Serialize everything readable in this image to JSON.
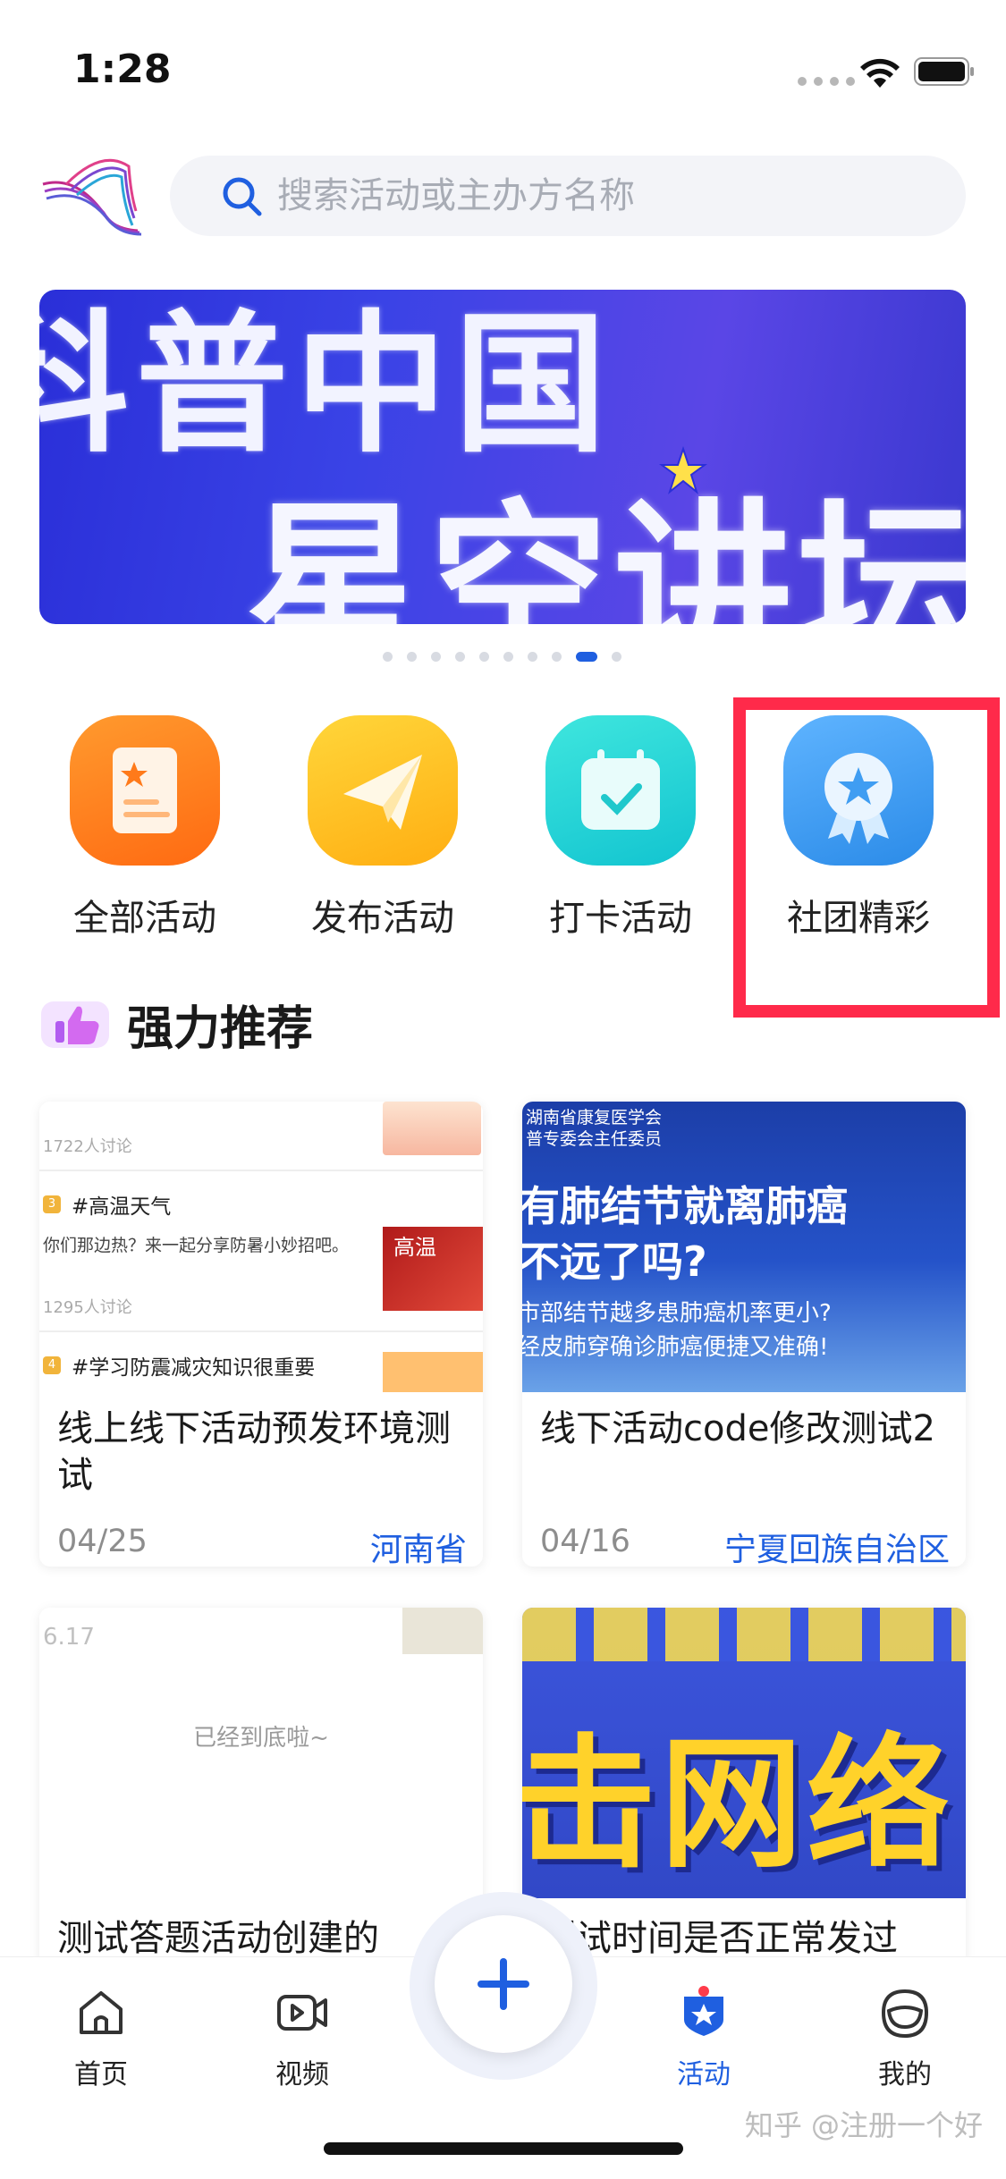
{
  "status_bar": {
    "time": "1:28"
  },
  "search": {
    "placeholder": "搜索活动或主办方名称"
  },
  "banner": {
    "line1": "科普中国",
    "line2": "星空讲坛",
    "page_count": 10,
    "active_page": 9
  },
  "quick_actions": [
    {
      "label": "全部活动",
      "icon": "document-star-icon",
      "color": "#ff7a1a"
    },
    {
      "label": "发布活动",
      "icon": "paper-plane-icon",
      "color": "#ffbf1f"
    },
    {
      "label": "打卡活动",
      "icon": "calendar-check-icon",
      "color": "#20d8d0"
    },
    {
      "label": "社团精彩",
      "icon": "medal-icon",
      "color": "#3f9df2"
    }
  ],
  "section": {
    "title": "强力推荐"
  },
  "cards": [
    {
      "title": "线上线下活动预发环境测试",
      "date": "04/25",
      "location": "河南省",
      "image": {
        "meta1": "1722人讨论",
        "badge1": "3",
        "tag1": "#高温天气",
        "desc1": "你们那边热？来一起分享防暑小妙招吧。",
        "thumb1": "高温",
        "meta2": "1295人讨论",
        "badge2": "4",
        "tag2": "#学习防震减灾知识很重要"
      }
    },
    {
      "title": "线下活动code修改测试2",
      "date": "04/16",
      "location": "宁夏回族自治区",
      "image": {
        "top": "湖南省康复医学会\n普专委会主任委员",
        "headline": "有肺结节就离肺癌\n不远了吗?",
        "sub": "市部结节越多患肺癌机率更小?\n经皮肺穿确诊肺癌便捷又准确!"
      }
    },
    {
      "title": "测试答题活动创建的",
      "date": "",
      "location": "",
      "image": {
        "date": "6.17",
        "end_text": "已经到底啦~"
      }
    },
    {
      "title": "测试时间是否正常发过",
      "date": "",
      "location": "",
      "image": {
        "text": "击网络"
      }
    }
  ],
  "tab_bar": {
    "items": [
      {
        "label": "首页",
        "icon": "home-icon",
        "active": false
      },
      {
        "label": "视频",
        "icon": "video-icon",
        "active": false
      },
      {
        "label": "活动",
        "icon": "activity-badge-icon",
        "active": true
      },
      {
        "label": "我的",
        "icon": "profile-icon",
        "active": false
      }
    ],
    "fab_icon": "plus-icon"
  },
  "watermark": "知乎 @注册一个好",
  "colors": {
    "accent": "#1f5fe0",
    "highlight": "#ff2a4a"
  }
}
